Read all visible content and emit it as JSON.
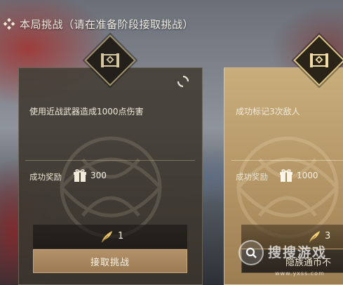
{
  "header": {
    "title": "本局挑战（请在准备阶段接取挑战）",
    "icon": "diamond-dots-icon"
  },
  "cards": [
    {
      "task": "使用近战武器造成1000点伤害",
      "reward_label": "成功奖励",
      "reward_value": "300",
      "count": "1",
      "button": "接取挑战",
      "emblem_icon": "scroll-emblem-icon",
      "theme_color": "#3e3830"
    },
    {
      "task": "成功标记3次敌人",
      "reward_label": "成功奖励",
      "reward_value": "1000",
      "count": "3",
      "button_partial": "隐族通币不",
      "emblem_icon": "scroll-emblem-icon",
      "theme_color": "#b89a68"
    }
  ],
  "watermark": {
    "text": "搜搜游戏",
    "url": "www.yxss.com"
  },
  "colors": {
    "gold": "#c9ae7c",
    "button": "#a88762",
    "dark_card": "#3e3830"
  }
}
